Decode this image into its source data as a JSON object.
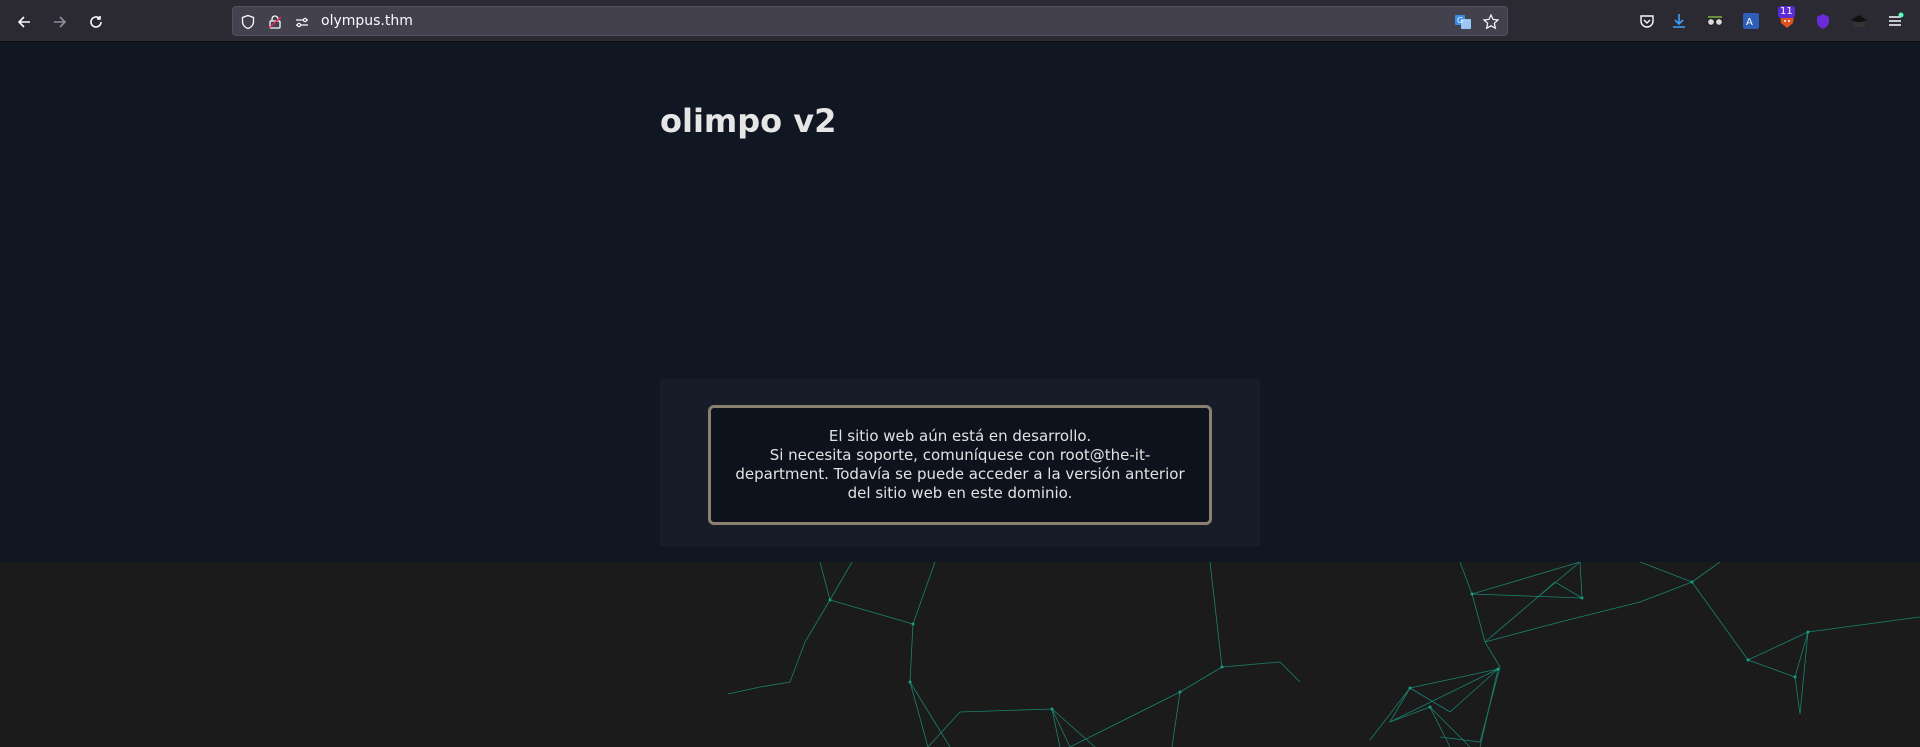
{
  "browser": {
    "url": "olympus.thm",
    "extension_badge": "11",
    "icons": {
      "back": "arrow-left-icon",
      "forward": "arrow-right-icon",
      "reload": "reload-icon",
      "tracking": "shield-icon",
      "lock": "lock-icon",
      "permissions": "permissions-icon",
      "translate": "translate-icon",
      "bookmark": "star-icon",
      "pocket": "pocket-icon",
      "downloads": "download-icon",
      "menu": "hamburger-menu-icon"
    }
  },
  "page": {
    "title": "olimpo v2",
    "notice_lines": [
      "El sitio web aún está en desarrollo.",
      "Si necesita soporte, comuníquese con root@the-it-department. Todavía se puede acceder a la versión anterior del sitio web en este dominio."
    ]
  },
  "colors": {
    "toolbar": "#2b2a33",
    "page_background": "#101622",
    "panel": "#171c28",
    "notice_border": "#8a8070",
    "network_lines": "#1aa58a"
  }
}
